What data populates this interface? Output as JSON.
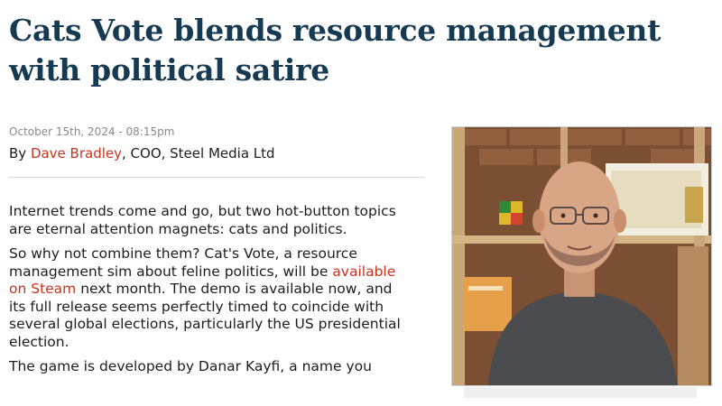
{
  "article": {
    "title": "Cats Vote blends resource management with political satire",
    "date": "October 15th, 2024 - 08:15pm",
    "byline_prefix": "By ",
    "author": "Dave Bradley",
    "author_suffix": ", COO, Steel Media Ltd",
    "paragraphs": {
      "p1": "Internet trends come and go, but two hot-button topics are eternal attention magnets: cats and politics.",
      "p2_before": "So why not combine them? Cat's Vote, a resource management sim about feline politics, will be ",
      "p2_link": "available on Steam",
      "p2_after": " next month. The demo is available now, and its full release seems perfectly timed to coincide with several global elections, particularly the US presidential election.",
      "p3": "The game is developed by Danar Kayfi, a name you"
    }
  },
  "colors": {
    "headline": "#163a52",
    "link": "#c8341c",
    "date": "#8a8a8a"
  }
}
